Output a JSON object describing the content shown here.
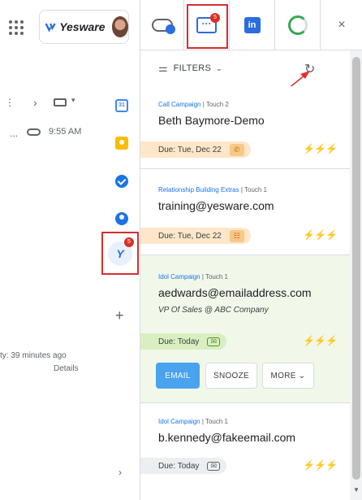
{
  "header": {
    "brand": "Yesware",
    "tab_message_badge": "5",
    "close_label": "×"
  },
  "gmail": {
    "row_time": "9:55 AM",
    "activity": "ty: 39 minutes ago",
    "details": "Details"
  },
  "rail": {
    "calendar_label": "31",
    "yesware_badge": "5",
    "add_label": "+"
  },
  "filters": {
    "label": "FILTERS",
    "caret": "⌄"
  },
  "cards": [
    {
      "campaign": "Call Campaign",
      "touch": " | Touch 2",
      "title": "Beth Baymore-Demo",
      "subtitle": "",
      "due": "Due: Tue, Dec 22",
      "due_icon": "phone-icon"
    },
    {
      "campaign": "Relationship Building Extras",
      "touch": " | Touch 1",
      "title": "training@yesware.com",
      "subtitle": "",
      "due": "Due: Tue, Dec 22",
      "due_icon": "task-icon"
    },
    {
      "campaign": "Idol Campaign",
      "touch": " | Touch 1",
      "title": "aedwards@emailaddress.com",
      "subtitle": "VP Of Sales @ ABC Company",
      "due": "Due: Today",
      "due_icon": "email-icon"
    },
    {
      "campaign": "Idol Campaign",
      "touch": " | Touch 1",
      "title": "b.kennedy@fakeemail.com",
      "subtitle": "",
      "due": "Due: Today",
      "due_icon": "email-icon"
    }
  ],
  "actions": {
    "email": "EMAIL",
    "snooze": "SNOOZE",
    "more": "MORE ⌄"
  },
  "colors": {
    "accent": "#2b6de0",
    "highlight_frame": "#d42f2f",
    "active_card": "#f1f8e9"
  }
}
